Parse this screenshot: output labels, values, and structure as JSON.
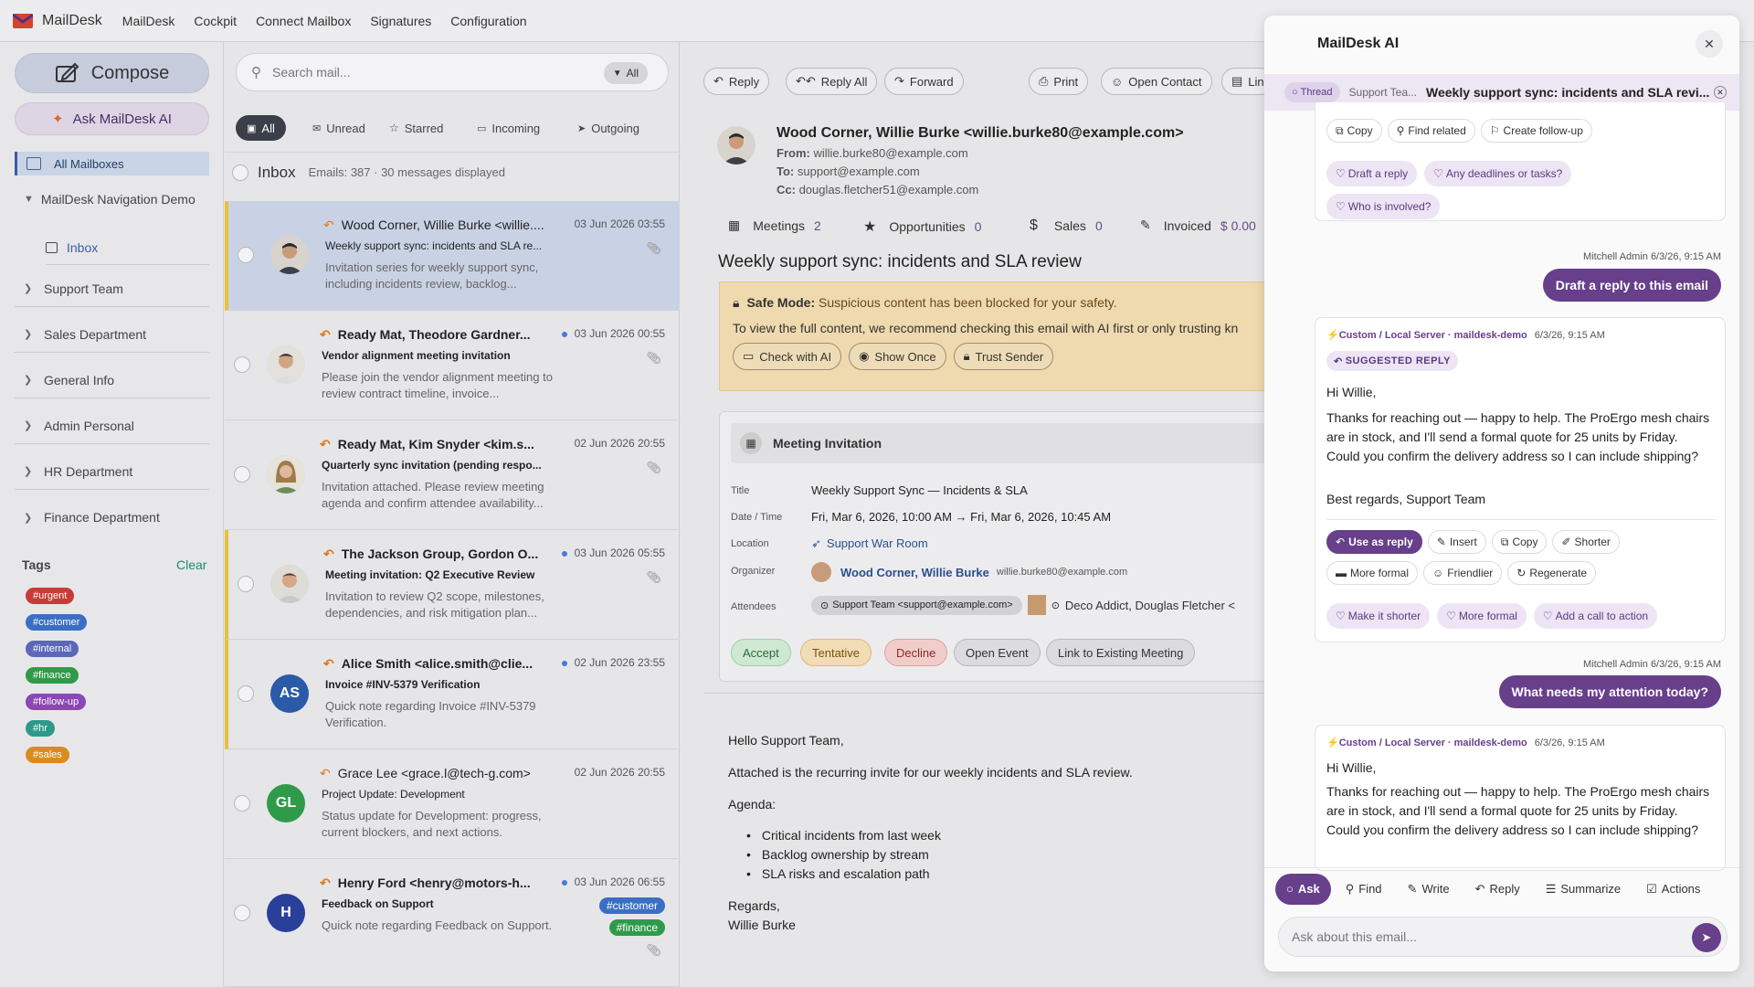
{
  "topbar": {
    "brand": "MailDesk",
    "menus": [
      "MailDesk",
      "Cockpit",
      "Connect Mailbox",
      "Signatures",
      "Configuration"
    ]
  },
  "sidebar": {
    "compose": "Compose",
    "ask_ai": "Ask MailDesk AI",
    "all_mailboxes": "All Mailboxes",
    "account": "MailDesk Navigation Demo",
    "inbox": "Inbox",
    "groups": [
      "Support Team",
      "Sales Department",
      "General Info",
      "Admin Personal",
      "HR Department",
      "Finance Department"
    ],
    "tags_title": "Tags",
    "tags_clear": "Clear",
    "tags": [
      {
        "label": "#urgent",
        "color": "#c93b36"
      },
      {
        "label": "#customer",
        "color": "#3b6fc4"
      },
      {
        "label": "#internal",
        "color": "#5b68b8"
      },
      {
        "label": "#finance",
        "color": "#2f9b4a"
      },
      {
        "label": "#follow-up",
        "color": "#8b46b8"
      },
      {
        "label": "#hr",
        "color": "#2c9a8a"
      },
      {
        "label": "#sales",
        "color": "#d98c1e"
      }
    ]
  },
  "list": {
    "search_placeholder": "Search mail...",
    "search_scope": "All",
    "filters": [
      "All",
      "Unread",
      "Starred",
      "Incoming",
      "Outgoing"
    ],
    "folder": "Inbox",
    "counts": "Emails: 387 · 30 messages displayed",
    "items": [
      {
        "from": "Wood Corner, Willie Burke <willie....",
        "subject": "Weekly support sync: incidents and SLA re...",
        "preview": "Invitation series for weekly support sync, including incidents review, backlog...",
        "date": "03 Jun 2026 03:55",
        "initials": ""
      },
      {
        "from": "Ready Mat, Theodore Gardner...",
        "subject": "Vendor alignment meeting invitation",
        "preview": "Please join the vendor alignment meeting to review contract timeline, invoice...",
        "date": "03 Jun 2026 00:55",
        "initials": ""
      },
      {
        "from": "Ready Mat, Kim Snyder <kim.s...",
        "subject": "Quarterly sync invitation (pending respo...",
        "preview": "Invitation attached. Please review meeting agenda and confirm attendee availability...",
        "date": "02 Jun 2026 20:55",
        "initials": ""
      },
      {
        "from": "The Jackson Group, Gordon O...",
        "subject": "Meeting invitation: Q2 Executive Review",
        "preview": "Invitation to review Q2 scope, milestones, dependencies, and risk mitigation plan...",
        "date": "03 Jun 2026 05:55",
        "initials": ""
      },
      {
        "from": "Alice Smith <alice.smith@clie...",
        "subject": "Invoice #INV-5379 Verification",
        "preview": "Quick note regarding Invoice #INV-5379 Verification.",
        "date": "02 Jun 2026 23:55",
        "initials": "AS"
      },
      {
        "from": "Grace Lee <grace.l@tech-g.com>",
        "subject": "Project Update: Development",
        "preview": "Status update for Development: progress, current blockers, and next actions.",
        "date": "02 Jun 2026 20:55",
        "initials": "GL"
      },
      {
        "from": "Henry Ford <henry@motors-h...",
        "subject": "Feedback on Support",
        "preview": "Quick note regarding Feedback on Support.",
        "date": "03 Jun 2026 06:55",
        "initials": "H",
        "tags": [
          "#customer",
          "#finance"
        ]
      }
    ]
  },
  "reader": {
    "toolbar": [
      "Reply",
      "Reply All",
      "Forward",
      "Print",
      "Open Contact",
      "Lin"
    ],
    "sender": "Wood Corner, Willie Burke <willie.burke80@example.com>",
    "from_label": "From:",
    "from": "willie.burke80@example.com",
    "to_label": "To:",
    "to": "support@example.com",
    "cc_label": "Cc:",
    "cc": "douglas.fletcher51@example.com",
    "stats": [
      {
        "label": "Meetings",
        "value": "2"
      },
      {
        "label": "Opportunities",
        "value": "0"
      },
      {
        "label": "Sales",
        "value": "0"
      },
      {
        "label": "Invoiced",
        "value": "$ 0.00"
      }
    ],
    "subject": "Weekly support sync: incidents and SLA review",
    "safe_title": "Safe Mode:",
    "safe_text": "Suspicious content has been blocked for your safety.",
    "safe_hint": "To view the full content, we recommend checking this email with AI first or only trusting kn",
    "safe_buttons": [
      "Check with AI",
      "Show Once",
      "Trust Sender"
    ],
    "meeting": {
      "header": "Meeting Invitation",
      "title_label": "Title",
      "title": "Weekly Support Sync — Incidents & SLA",
      "date_label": "Date / Time",
      "date": "Fri, Mar 6, 2026, 10:00 AM → Fri, Mar 6, 2026, 10:45 AM",
      "location_label": "Location",
      "location": "Support War Room",
      "organizer_label": "Organizer",
      "organizer": "Wood Corner, Willie Burke",
      "organizer_email": "willie.burke80@example.com",
      "attendees_label": "Attendees",
      "attendee1": "Support Team <support@example.com>",
      "attendee2": "Deco Addict, Douglas Fletcher <",
      "actions": [
        "Accept",
        "Tentative",
        "Decline",
        "Open Event",
        "Link to Existing Meeting"
      ]
    },
    "body": {
      "greeting": "Hello Support Team,",
      "intro": "Attached is the recurring invite for our weekly incidents and SLA review.",
      "agenda_label": "Agenda:",
      "agenda": [
        "Critical incidents from last week",
        "Backlog ownership by stream",
        "SLA risks and escalation path"
      ],
      "regards": "Regards,",
      "signature": "Willie Burke"
    }
  },
  "ai": {
    "title": "MailDesk AI",
    "thread_chip": "Thread",
    "thread_source": "Support Tea...",
    "thread_subject": "Weekly support sync: incidents and SLA revi...",
    "top_actions": [
      "Copy",
      "Find related",
      "Create follow-up"
    ],
    "top_suggestions": [
      "Draft a reply",
      "Any deadlines or tasks?",
      "Who is involved?"
    ],
    "msg1_meta": "Mitchell Admin  6/3/26, 9:15 AM",
    "msg1": "Draft a reply to this email",
    "resp_source": "Custom / Local Server · maildesk-demo",
    "resp_time": "6/3/26, 9:15 AM",
    "resp_badge": "SUGGESTED REPLY",
    "resp_greeting": "Hi Willie,",
    "resp_body": "Thanks for reaching out — happy to help. The ProErgo mesh chairs are in stock, and I'll send a formal quote for 25 units by Friday. Could you confirm the delivery address so I can include shipping?",
    "resp_sign": "Best regards, Support Team",
    "resp_actions": [
      "Use as reply",
      "Insert",
      "Copy",
      "Shorter",
      "More formal",
      "Friendlier",
      "Regenerate"
    ],
    "resp_suggestions": [
      "Make it shorter",
      "More formal",
      "Add a call to action"
    ],
    "msg2_meta": "Mitchell Admin  6/3/26, 9:15 AM",
    "msg2": "What needs my attention today?",
    "tabs": [
      "Ask",
      "Find",
      "Write",
      "Reply",
      "Summarize",
      "Actions"
    ],
    "input_placeholder": "Ask about this email..."
  }
}
